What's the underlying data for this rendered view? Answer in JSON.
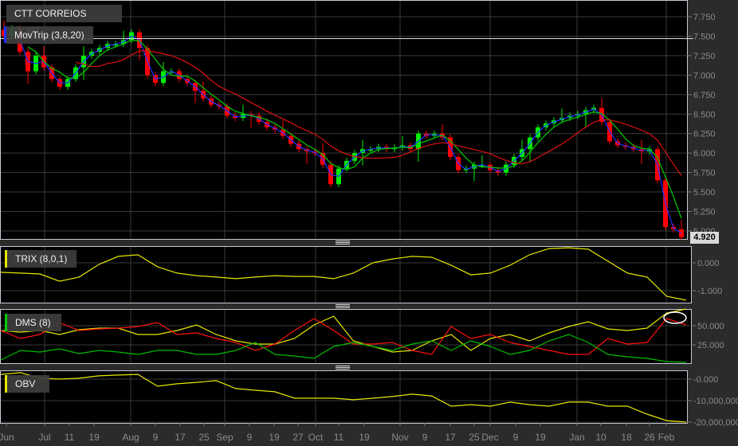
{
  "title": "CTT CORREIOS PORT",
  "last_price": "4.920",
  "colors": {
    "up": "#00ee00",
    "down": "#ff0000",
    "ma_fast": "#2030ff",
    "ma_mid": "#00cc00",
    "ma_slow": "#dd1010",
    "trix": "#e6e600",
    "dms_adx": "#e6e600",
    "dms_plus": "#ff1010",
    "dms_minus": "#00bb00",
    "obv": "#e6e600"
  },
  "chart_data": [
    {
      "type": "candlestick",
      "name": "price",
      "legend": "MovTrip (3,8,20)",
      "ma_periods": [
        3,
        8,
        20
      ],
      "ylim": [
        4.9,
        7.95
      ],
      "y_ticks": [
        "7.750",
        "7.500",
        "7.250",
        "7.000",
        "6.750",
        "6.500",
        "6.250",
        "6.000",
        "5.750",
        "5.500",
        "5.250",
        "5.000"
      ],
      "close": [
        7.5,
        7.6,
        7.3,
        7.05,
        7.25,
        7.1,
        6.95,
        6.85,
        6.95,
        7.1,
        7.25,
        7.3,
        7.35,
        7.4,
        7.4,
        7.45,
        7.55,
        7.35,
        7.0,
        6.9,
        7.05,
        7.05,
        6.95,
        6.9,
        6.8,
        6.7,
        6.62,
        6.6,
        6.48,
        6.45,
        6.5,
        6.48,
        6.4,
        6.33,
        6.3,
        6.22,
        6.12,
        6.05,
        6.02,
        6.0,
        5.85,
        5.6,
        5.8,
        5.9,
        6.0,
        6.05,
        6.05,
        6.08,
        6.05,
        6.07,
        6.1,
        6.05,
        6.25,
        6.22,
        6.25,
        6.2,
        5.95,
        5.78,
        5.8,
        5.85,
        5.85,
        5.78,
        5.75,
        5.85,
        5.95,
        6.05,
        6.2,
        6.33,
        6.38,
        6.42,
        6.45,
        6.48,
        6.5,
        6.55,
        6.58,
        6.4,
        6.15,
        6.1,
        6.08,
        6.05,
        6.02,
        6.05,
        5.65,
        5.05,
        5.02,
        4.92
      ],
      "x_ticks": [
        {
          "label": "Jun",
          "index": 0.3
        },
        {
          "label": "Jul",
          "index": 5.1
        },
        {
          "label": "11",
          "index": 8.2
        },
        {
          "label": "19",
          "index": 11.3
        },
        {
          "label": "Aug",
          "index": 15.9
        },
        {
          "label": "9",
          "index": 19.0
        },
        {
          "label": "17",
          "index": 22.1
        },
        {
          "label": "25",
          "index": 25.1
        },
        {
          "label": "Sep",
          "index": 27.7
        },
        {
          "label": "9",
          "index": 30.8
        },
        {
          "label": "19",
          "index": 33.9
        },
        {
          "label": "27",
          "index": 36.9
        },
        {
          "label": "Oct",
          "index": 39.1
        },
        {
          "label": "11",
          "index": 42.0
        },
        {
          "label": "19",
          "index": 45.2
        },
        {
          "label": "Nov",
          "index": 49.7
        },
        {
          "label": "9",
          "index": 52.8
        },
        {
          "label": "17",
          "index": 56.0
        },
        {
          "label": "25",
          "index": 59.0
        },
        {
          "label": "Dec",
          "index": 61.0
        },
        {
          "label": "9",
          "index": 64.2
        },
        {
          "label": "19",
          "index": 67.3
        },
        {
          "label": "Jan",
          "index": 71.9
        },
        {
          "label": "10",
          "index": 74.9
        },
        {
          "label": "18",
          "index": 78.1
        },
        {
          "label": "26",
          "index": 81.0
        },
        {
          "label": "Feb",
          "index": 83.1
        }
      ],
      "month_gridlines": [
        5.1,
        15.9,
        27.7,
        39.1,
        49.7,
        61.0,
        71.9,
        83.1
      ]
    },
    {
      "type": "line",
      "name": "trix",
      "legend": "TRIX (8,0,1)",
      "ylim": [
        -1.4,
        0.6
      ],
      "y_ticks": [
        "0.000",
        "-1.000"
      ],
      "values": [
        -0.34,
        -0.37,
        -0.4,
        -0.66,
        -0.51,
        -0.06,
        0.23,
        0.29,
        -0.14,
        -0.37,
        -0.46,
        -0.51,
        -0.57,
        -0.51,
        -0.46,
        -0.49,
        -0.49,
        -0.57,
        -0.37,
        0.0,
        0.14,
        0.23,
        0.2,
        -0.09,
        -0.43,
        -0.37,
        -0.09,
        0.29,
        0.51,
        0.54,
        0.49,
        0.06,
        -0.37,
        -0.51,
        -1.2,
        -1.34
      ]
    },
    {
      "type": "line",
      "name": "dms",
      "legend": "DMS (8)",
      "ylim": [
        0,
        72
      ],
      "y_ticks": [
        "50.000",
        "25.000"
      ],
      "series": [
        {
          "name": "adx",
          "values": [
            43.8,
            41.7,
            43.8,
            38.5,
            44.8,
            46.9,
            46.9,
            38.5,
            38.5,
            43.8,
            51.0,
            38.5,
            30.2,
            26.0,
            26.0,
            33.3,
            51.0,
            62.5,
            30.2,
            22.9,
            15.6,
            17.7,
            30.2,
            38.5,
            17.7,
            33.3,
            38.5,
            30.2,
            40.6,
            49.0,
            55.2,
            45.8,
            43.8,
            46.9,
            66.7,
            71.9
          ]
        },
        {
          "name": "plus_di",
          "values": [
            43.8,
            33.3,
            38.5,
            54.2,
            43.8,
            45.8,
            46.9,
            49.0,
            54.2,
            38.5,
            40.6,
            33.3,
            28.1,
            17.7,
            26.0,
            43.8,
            59.4,
            43.8,
            26.0,
            26.0,
            28.1,
            17.7,
            12.5,
            49.0,
            33.3,
            38.5,
            28.1,
            22.9,
            17.7,
            12.5,
            12.5,
            33.3,
            26.0,
            28.1,
            59.4,
            51.0
          ]
        },
        {
          "name": "minus_di",
          "values": [
            5.2,
            17.7,
            15.6,
            19.8,
            13.5,
            17.7,
            15.6,
            12.5,
            17.7,
            17.7,
            12.5,
            12.5,
            17.7,
            28.1,
            12.5,
            10.4,
            7.3,
            22.9,
            28.1,
            22.9,
            17.7,
            26.0,
            30.2,
            17.7,
            30.2,
            22.9,
            12.5,
            17.7,
            30.2,
            38.5,
            28.1,
            12.5,
            9.4,
            7.3,
            3.1,
            2.1
          ]
        }
      ]
    },
    {
      "type": "line",
      "name": "obv",
      "legend": "OBV",
      "unit": "millions",
      "ylim": [
        -20.2,
        4.2
      ],
      "y_ticks": [
        "-0.000",
        "-10,000,000",
        "-20,000,000"
      ],
      "values": [
        2.2,
        3.0,
        0.4,
        0,
        0.4,
        1.5,
        1.9,
        2.2,
        -3.3,
        -2.2,
        -1.5,
        -0.7,
        -4.4,
        -5.2,
        -5.9,
        -8.9,
        -8.9,
        -8.9,
        -9.6,
        -8.9,
        -8.1,
        -7.0,
        -7.8,
        -12.6,
        -11.9,
        -12.6,
        -10.7,
        -11.9,
        -12.6,
        -10.7,
        -10.7,
        -12.6,
        -12.6,
        -16.3,
        -19.3,
        -20.0
      ]
    }
  ]
}
